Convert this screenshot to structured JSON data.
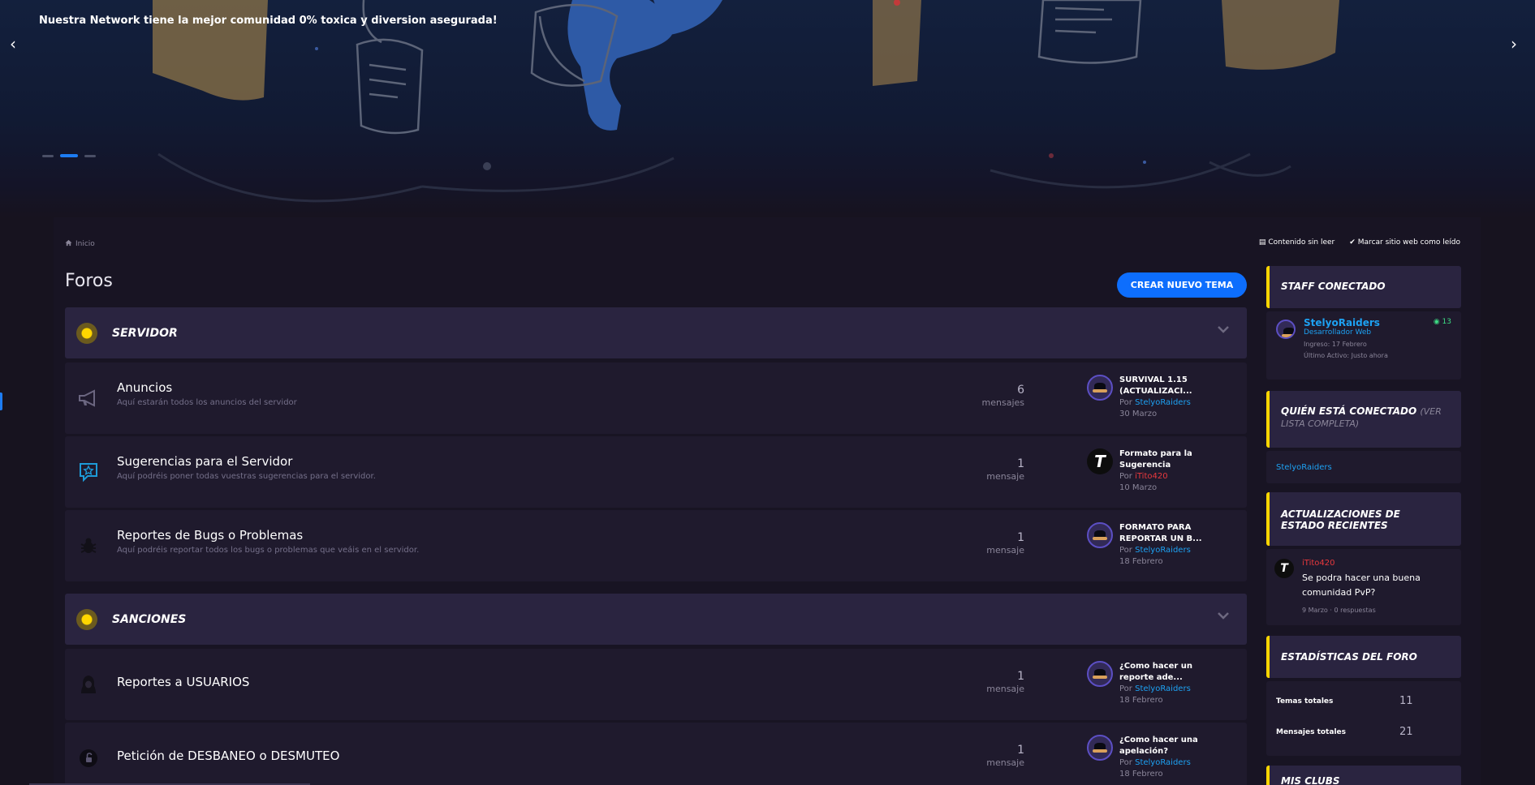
{
  "hero": {
    "text": "Nuestra Network tiene la mejor comunidad 0% toxica y diversion asegurada!",
    "prev_arrow": "‹",
    "next_arrow": "›",
    "slide_count": 3,
    "active_slide": 2
  },
  "breadcrumb": {
    "home_icon": "home-icon",
    "home_label": "Inicio"
  },
  "top_links": {
    "unread_label": "Contenido sin leer",
    "mark_read_label": "Marcar sitio web como leído"
  },
  "page_title": "Foros",
  "new_topic_button": "CREAR NUEVO TEMA",
  "categories": [
    {
      "title": "SERVIDOR",
      "forums": [
        {
          "title": "Anuncios",
          "description": "Aquí estarán todos los anuncios del servidor",
          "icon": "megaphone-icon",
          "count": "6",
          "count_label": "mensajes",
          "last_title": "SURVIVAL 1.15 (ACTUALIZACI...",
          "last_by_prefix": "Por",
          "last_by_user": "StelyoRaiders",
          "last_date": "30 Marzo"
        },
        {
          "title": "Sugerencias para el Servidor",
          "description": "Aquí podréis poner todas vuestras sugerencias para el servidor.",
          "icon": "star-speech-icon",
          "count": "1",
          "count_label": "mensaje",
          "last_title": "Formato para la Sugerencia",
          "last_by_prefix": "Por",
          "last_by_user": "iTito420",
          "last_date": "10 Marzo"
        },
        {
          "title": "Reportes de Bugs o Problemas",
          "description": "Aquí podréis reportar todos los bugs o problemas que veáis en el servidor.",
          "icon": "bug-icon",
          "count": "1",
          "count_label": "mensaje",
          "last_title": "FORMATO PARA REPORTAR UN B...",
          "last_by_prefix": "Por",
          "last_by_user": "StelyoRaiders",
          "last_date": "18 Febrero"
        }
      ]
    },
    {
      "title": "SANCIONES",
      "forums": [
        {
          "title": "Reportes a USUARIOS",
          "description": "",
          "icon": "hooded-user-icon",
          "count": "1",
          "count_label": "mensaje",
          "last_title": "¿Como hacer un reporte ade...",
          "last_by_prefix": "Por",
          "last_by_user": "StelyoRaiders",
          "last_date": "18 Febrero"
        },
        {
          "title": "Petición de DESBANEO o DESMUTEO",
          "description": "",
          "icon": "unlock-icon",
          "count": "1",
          "count_label": "mensaje",
          "last_title": "¿Como hacer una apelación?",
          "last_by_prefix": "Por",
          "last_by_user": "StelyoRaiders",
          "last_date": "18 Febrero"
        }
      ]
    }
  ],
  "sidebar": {
    "staff": {
      "title": "STAFF CONECTADO",
      "name": "StelyoRaiders",
      "role": "Desarrollador Web",
      "joined": "Ingreso: 17 Febrero",
      "last_active": "Último Activo: Justo ahora",
      "count": "13"
    },
    "online": {
      "title": "QUIÉN ESTÁ CONECTADO",
      "title_sub": "(VER LISTA COMPLETA)",
      "user": "StelyoRaiders"
    },
    "updates": {
      "title": "ACTUALIZACIONES DE ESTADO RECIENTES",
      "user": "iTito420",
      "text": "Se podra hacer una buena comunidad PvP?",
      "meta": "9 Marzo · 0 respuestas"
    },
    "stats": {
      "title": "ESTADÍSTICAS DEL FORO",
      "topics_label": "Temas totales",
      "topics_value": "11",
      "posts_label": "Mensajes totales",
      "posts_value": "21"
    },
    "next_title": "MIS CLUBS"
  },
  "colors": {
    "accent": "#0d6efd",
    "category_dot": "#ffd600",
    "username_blue": "#1da1f2",
    "username_red": "#e8383d",
    "online_green": "#3ddc84"
  }
}
